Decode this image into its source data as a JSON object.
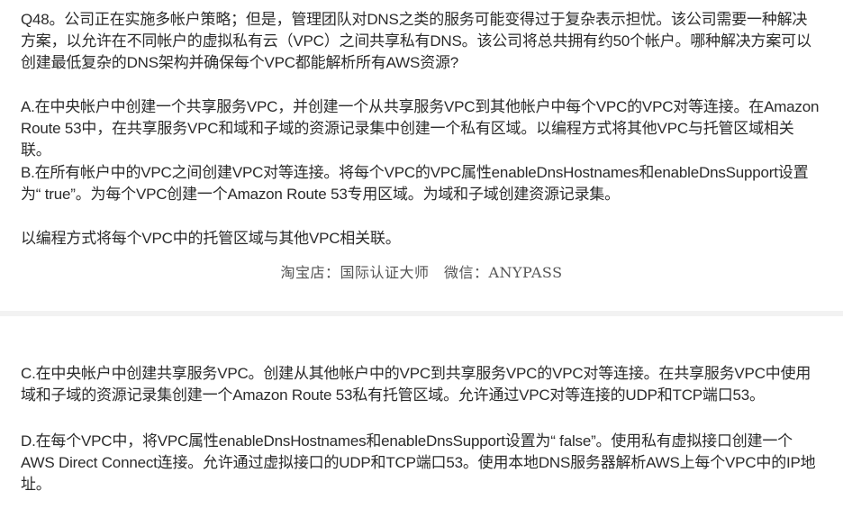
{
  "page1": {
    "question": "Q48。公司正在实施多帐户策略；但是，管理团队对DNS之类的服务可能变得过于复杂表示担忧。该公司需要一种解决方案，以允许在不同帐户的虚拟私有云（VPC）之间共享私有DNS。该公司将总共拥有约50个帐户。哪种解决方案可以创建最低复杂的DNS架构并确保每个VPC都能解析所有AWS资源?",
    "option_a": "A.在中央帐户中创建一个共享服务VPC，并创建一个从共享服务VPC到其他帐户中每个VPC的VPC对等连接。在Amazon Route 53中，在共享服务VPC和域和子域的资源记录集中创建一个私有区域。以编程方式将其他VPC与托管区域相关联。",
    "option_b": "B.在所有帐户中的VPC之间创建VPC对等连接。将每个VPC的VPC属性enableDnsHostnames和enableDnsSupport设置为“ true”。为每个VPC创建一个Amazon Route 53专用区域。为域和子域创建资源记录集。",
    "option_b_cont": "以编程方式将每个VPC中的托管区域与其他VPC相关联。",
    "watermark": "淘宝店：国际认证大师　微信：ANYPASS"
  },
  "page2": {
    "option_c": "C.在中央帐户中创建共享服务VPC。创建从其他帐户中的VPC到共享服务VPC的VPC对等连接。在共享服务VPC中使用域和子域的资源记录集创建一个Amazon Route 53私有托管区域。允许通过VPC对等连接的UDP和TCP端口53。",
    "option_d": "D.在每个VPC中，将VPC属性enableDnsHostnames和enableDnsSupport设置为“ false”。使用私有虚拟接口创建一个AWS Direct Connect连接。允许通过虚拟接口的UDP和TCP端口53。使用本地DNS服务器解析AWS上每个VPC中的IP地址。"
  }
}
